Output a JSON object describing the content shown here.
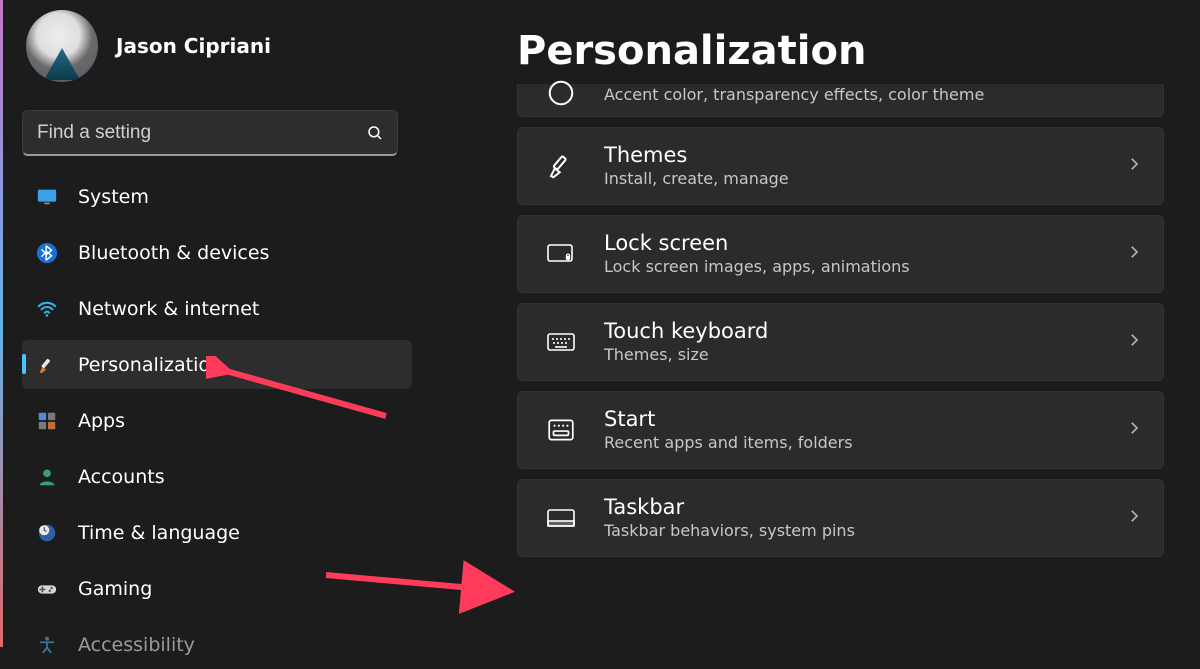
{
  "user": {
    "name": "Jason Cipriani"
  },
  "search": {
    "placeholder": "Find a setting"
  },
  "page": {
    "title": "Personalization"
  },
  "sidebar": {
    "items": [
      {
        "label": "System",
        "icon": "monitor-icon",
        "active": false
      },
      {
        "label": "Bluetooth & devices",
        "icon": "bluetooth-icon",
        "active": false
      },
      {
        "label": "Network & internet",
        "icon": "wifi-icon",
        "active": false
      },
      {
        "label": "Personalization",
        "icon": "paintbrush-icon",
        "active": true
      },
      {
        "label": "Apps",
        "icon": "apps-icon",
        "active": false
      },
      {
        "label": "Accounts",
        "icon": "person-icon",
        "active": false
      },
      {
        "label": "Time & language",
        "icon": "clock-globe-icon",
        "active": false
      },
      {
        "label": "Gaming",
        "icon": "gamepad-icon",
        "active": false
      },
      {
        "label": "Accessibility",
        "icon": "accessibility-icon",
        "active": false
      }
    ]
  },
  "cards": {
    "partial": {
      "subtitle": "Accent color, transparency effects, color theme"
    },
    "items": [
      {
        "title": "Themes",
        "subtitle": "Install, create, manage",
        "icon": "paintbrush-outline-icon"
      },
      {
        "title": "Lock screen",
        "subtitle": "Lock screen images, apps, animations",
        "icon": "lockscreen-icon"
      },
      {
        "title": "Touch keyboard",
        "subtitle": "Themes, size",
        "icon": "keyboard-icon"
      },
      {
        "title": "Start",
        "subtitle": "Recent apps and items, folders",
        "icon": "startmenu-icon"
      },
      {
        "title": "Taskbar",
        "subtitle": "Taskbar behaviors, system pins",
        "icon": "taskbar-icon"
      }
    ]
  },
  "colors": {
    "accent": "#4cc2ff",
    "arrow": "#ff3b5c"
  }
}
